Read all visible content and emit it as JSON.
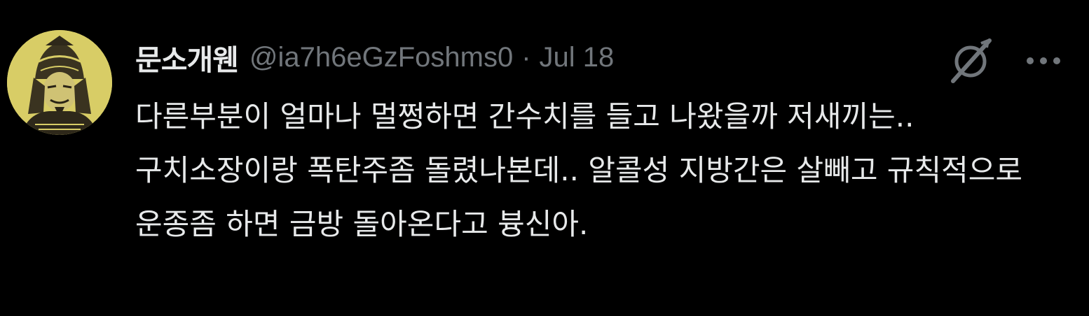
{
  "post": {
    "author": {
      "display_name": "문소개웬",
      "handle": "@ia7h6eGzFoshms0"
    },
    "separator": "·",
    "date": "Jul 18",
    "text": "다른부분이 얼마나 멀쩡하면 간수치를 들고 나왔을까 저새끼는.. 구치소장이랑 폭탄주좀 돌렸나본데.. 알콜성 지방간은 살빼고 규칙적으로 운종좀 하면 금방 돌아온다고 븅신아."
  },
  "icons": {
    "grok": "grok-slash-icon",
    "more": "more-dots-icon"
  },
  "colors": {
    "background": "#000000",
    "primary_text": "#e7e9ea",
    "secondary_text": "#71767b"
  }
}
